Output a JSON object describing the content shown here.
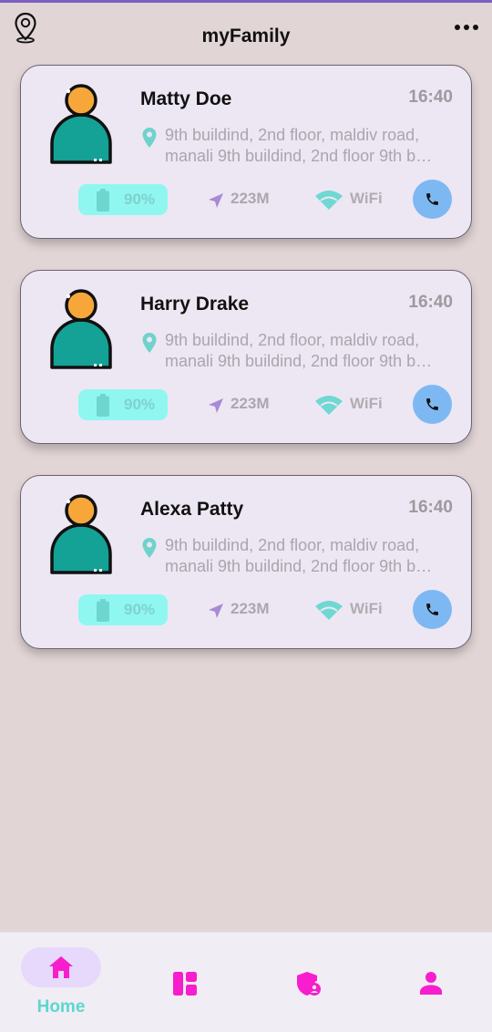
{
  "app": {
    "title": "myFamily",
    "header_left_icon": "location-pin-outline-icon",
    "header_right_icon": "more-horizontal-icon"
  },
  "colors": {
    "background": "#e2d5d6",
    "card_bg": "#ede7f4",
    "avatar_head": "#f7a73a",
    "avatar_body": "#14a196",
    "pin": "#6fd3cc",
    "battery_pill": "#8ff7f0",
    "distance_icon": "#a98ad6",
    "wifi_icon": "#70d8d2",
    "call_button": "#7eb8f3",
    "nav_active": "#f81dcd",
    "nav_home_label": "#5dd6cf"
  },
  "members": [
    {
      "name": "Matty Doe",
      "time": "16:40",
      "address": "9th buildind, 2nd floor, maldiv road, manali 9th buildind, 2nd floor 9th b…",
      "battery": "90%",
      "distance": "223M",
      "network": "WiFi"
    },
    {
      "name": "Harry Drake",
      "time": "16:40",
      "address": "9th buildind, 2nd floor, maldiv road, manali 9th buildind, 2nd floor 9th b…",
      "battery": "90%",
      "distance": "223M",
      "network": "WiFi"
    },
    {
      "name": "Alexa Patty",
      "time": "16:40",
      "address": "9th buildind, 2nd floor, maldiv road, manali 9th buildind, 2nd floor 9th b…",
      "battery": "90%",
      "distance": "223M",
      "network": "WiFi"
    }
  ],
  "bottom_nav": {
    "items": [
      {
        "icon": "home-icon",
        "label": "Home",
        "active": true
      },
      {
        "icon": "dashboard-icon"
      },
      {
        "icon": "shield-user-icon"
      },
      {
        "icon": "person-icon"
      }
    ]
  }
}
